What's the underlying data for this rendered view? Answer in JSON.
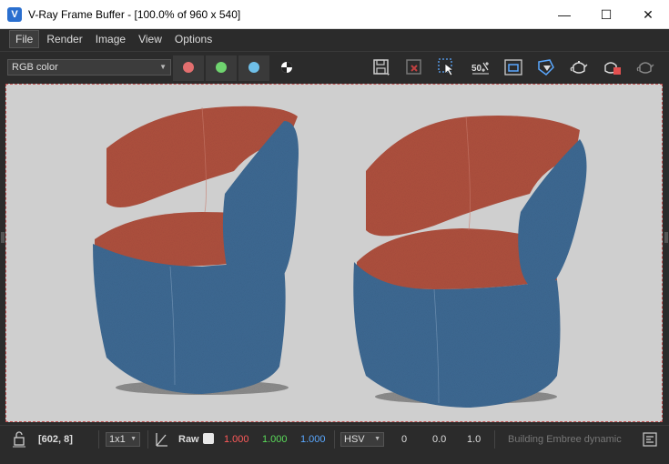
{
  "window": {
    "title": "V-Ray Frame Buffer - [100.0% of 960 x 540]",
    "app_icon_glyph": "V",
    "minimize_glyph": "—",
    "maximize_glyph": "☐",
    "close_glyph": "✕"
  },
  "menu": {
    "items": [
      "File",
      "Render",
      "Image",
      "View",
      "Options"
    ],
    "active": "File"
  },
  "toolbar": {
    "channel_select": "RGB color",
    "colors": {
      "red_dot": "#e36f6f",
      "green_dot": "#6fd46f",
      "blue_dot": "#6fbfe8"
    },
    "icons": [
      "save-icon",
      "clear-image-icon",
      "track-mouse-icon",
      "render-50-icon",
      "region-render-icon",
      "interactive-render-icon",
      "render-teapot-icon",
      "stop-render-icon",
      "render-last-icon"
    ],
    "render50_label": "50"
  },
  "status": {
    "coords": "[602, 8]",
    "zoom_select": "1x1",
    "raw_label": "Raw",
    "r_value": "1.000",
    "g_value": "1.000",
    "b_value": "1.000",
    "mode_select": "HSV",
    "h_value": "0",
    "s_value": "0.0",
    "v_value": "1.0",
    "message": "Building Embree dynamic",
    "colors": {
      "r": "#ff5a5a",
      "g": "#5adb5a",
      "b": "#5aa8ff"
    }
  }
}
